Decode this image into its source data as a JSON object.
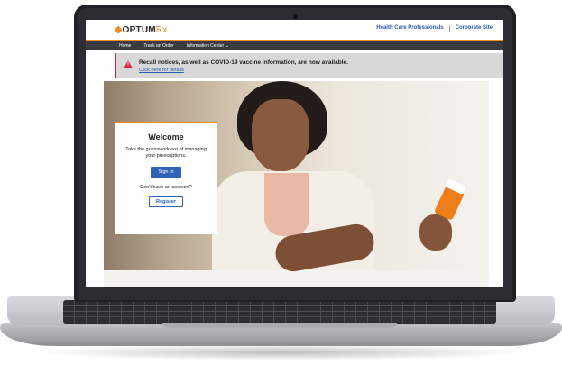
{
  "header": {
    "logo_text": "OPTUM",
    "logo_suffix": "Rx",
    "links": [
      "Health Care Professionals",
      "Corporate Site"
    ]
  },
  "nav": {
    "items": [
      "Home",
      "Track an Order",
      "Information Center ⌄"
    ]
  },
  "notice": {
    "title": "Recall notices, as well as COVID-19 vaccine information, are now available.",
    "link": "Click here for details"
  },
  "welcome": {
    "title": "Welcome",
    "subtitle": "Take the guesswork out of managing your prescriptions.",
    "signin_label": "Sign In",
    "no_account": "Don't have an account?",
    "register_label": "Register"
  },
  "colors": {
    "accent": "#f08a24",
    "link": "#2a5bb7",
    "alert": "#d0263a",
    "nav_bg": "#3b3b3f"
  },
  "icons": {
    "notice": "warning-triangle-icon",
    "logo": "optum-logo-icon"
  }
}
